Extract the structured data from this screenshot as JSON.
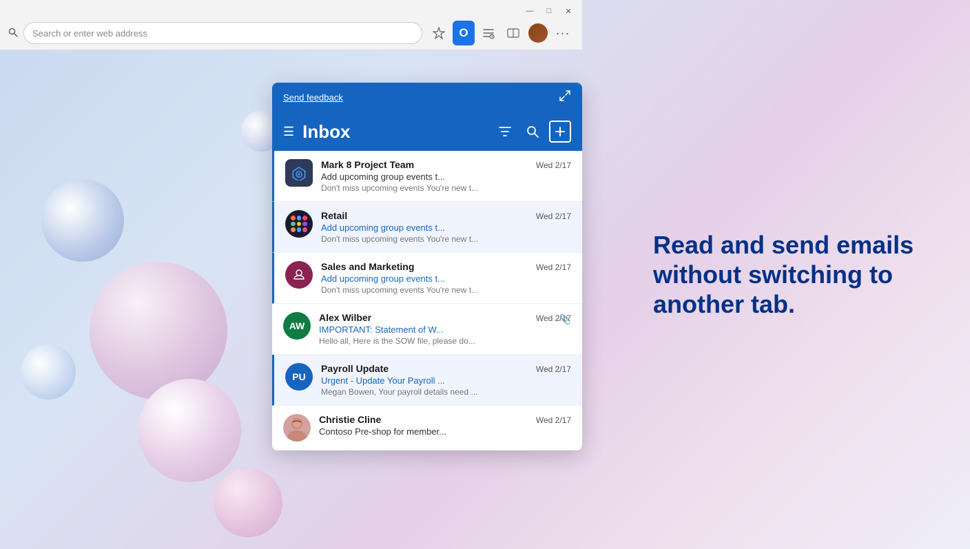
{
  "background": {
    "gradient": "linear-gradient(135deg, #c8d8f0, #d8e4f4, #e4d0e8, #f0e0ee)"
  },
  "right_text": {
    "heading": "Read and send emails without switching to another tab."
  },
  "browser": {
    "address_placeholder": "Search or enter web address",
    "window_buttons": {
      "minimize": "—",
      "maximize": "□",
      "close": "✕"
    }
  },
  "mail_panel": {
    "send_feedback_label": "Send feedback",
    "inbox_title": "Inbox",
    "emails": [
      {
        "id": "mark8",
        "sender": "Mark 8 Project Team",
        "subject": "Add upcoming group events t...",
        "preview": "Don't miss upcoming events You're new t...",
        "date": "Wed 2/17",
        "avatar_text": "✦",
        "avatar_type": "mark8",
        "unread": true,
        "selected": false
      },
      {
        "id": "retail",
        "sender": "Retail",
        "subject": "Add upcoming group events t...",
        "preview": "Don't miss upcoming events You're new t...",
        "date": "Wed 2/17",
        "avatar_type": "retail",
        "unread": true,
        "selected": true
      },
      {
        "id": "sales",
        "sender": "Sales and Marketing",
        "subject": "Add upcoming group events t...",
        "preview": "Don't miss upcoming events You're new t...",
        "date": "Wed 2/17",
        "avatar_type": "sales",
        "unread": true,
        "selected": false
      },
      {
        "id": "alex",
        "sender": "Alex Wilber",
        "subject": "IMPORTANT: Statement of W...",
        "preview": "Hello all, Here is the SOW file, please do...",
        "date": "Wed 2/17",
        "avatar_text": "AW",
        "avatar_type": "alex",
        "has_attachment": true,
        "unread": false,
        "selected": false
      },
      {
        "id": "payroll",
        "sender": "Payroll Update",
        "subject": "Urgent - Update Your Payroll ...",
        "preview": "Megan Bowen, Your payroll details need ...",
        "date": "Wed 2/17",
        "avatar_text": "PU",
        "avatar_type": "payroll",
        "unread": true,
        "selected": true
      },
      {
        "id": "christie",
        "sender": "Christie Cline",
        "subject": "Contoso Pre-shop for member...",
        "date": "Wed 2/17",
        "avatar_type": "christie",
        "unread": false,
        "selected": false
      }
    ]
  }
}
